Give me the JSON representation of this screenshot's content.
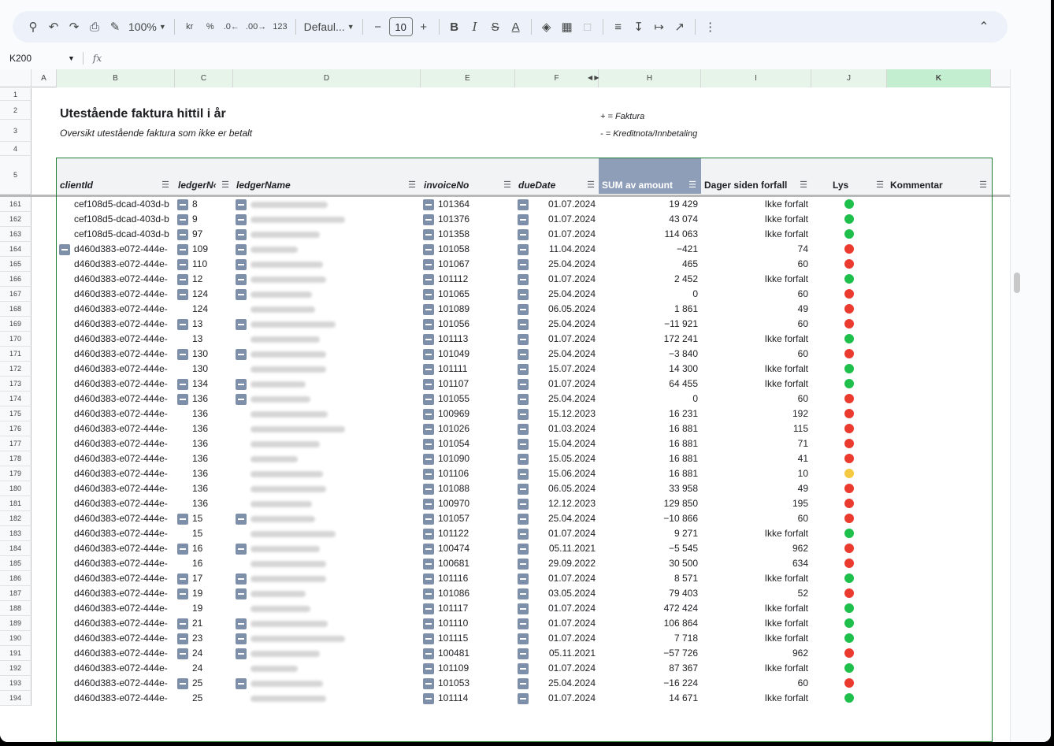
{
  "toolbar": {
    "zoom": "100%",
    "currency": "kr",
    "percent": "%",
    "dec_less": ".0←",
    "dec_more": ".00→",
    "format_123": "123",
    "font": "Defaul...",
    "font_size": "10",
    "bold": "B",
    "italic": "I",
    "text_color": "A",
    "more": "⋮"
  },
  "formula_bar": {
    "name_box": "K200",
    "fx": "fx"
  },
  "columns": [
    "A",
    "B",
    "C",
    "D",
    "E",
    "F",
    "H",
    "I",
    "J",
    "K"
  ],
  "sheet": {
    "title": "Utestående faktura hittil i år",
    "subtitle": "Oversikt utestående faktura som ikke er betalt",
    "legend_plus": "+ = Faktura",
    "legend_minus": "- = Kreditnota/Innbetaling"
  },
  "pivot_headers": {
    "clientId": "clientId",
    "ledgerNo": "ledgerN‹",
    "ledgerName": "ledgerName",
    "invoiceNo": "invoiceNo",
    "dueDate": "dueDate",
    "sum": "SUM av amount",
    "days": "Dager siden forfall",
    "lys": "Lys",
    "comment": "Kommentar"
  },
  "top_rows": [
    "1",
    "2",
    "3",
    "4",
    "5"
  ],
  "colors": {
    "green": "#1fbf4b",
    "red": "#ea3b2e",
    "yellow": "#f6c943",
    "pivot_button": "#7d8fa9",
    "sum_header": "#8e9eb8"
  },
  "rows": [
    {
      "n": "161",
      "client": "cef108d5-dcad-403d-b",
      "cm": false,
      "ledger": "8",
      "lm": true,
      "nm": true,
      "inv": "101364",
      "due": "01.07.2024",
      "sum": "19 429",
      "days": "Ikke forfalt",
      "lys": "green"
    },
    {
      "n": "162",
      "client": "cef108d5-dcad-403d-b",
      "cm": false,
      "ledger": "9",
      "lm": true,
      "nm": true,
      "inv": "101376",
      "due": "01.07.2024",
      "sum": "43 074",
      "days": "Ikke forfalt",
      "lys": "green"
    },
    {
      "n": "163",
      "client": "cef108d5-dcad-403d-b",
      "cm": false,
      "ledger": "97",
      "lm": true,
      "nm": true,
      "inv": "101358",
      "due": "01.07.2024",
      "sum": "114 063",
      "days": "Ikke forfalt",
      "lys": "green"
    },
    {
      "n": "164",
      "client": "d460d383-e072-444e-",
      "cm": true,
      "ledger": "109",
      "lm": true,
      "nm": true,
      "inv": "101058",
      "due": "11.04.2024",
      "sum": "−421",
      "days": "74",
      "lys": "red"
    },
    {
      "n": "165",
      "client": "d460d383-e072-444e-",
      "cm": false,
      "ledger": "110",
      "lm": true,
      "nm": true,
      "inv": "101067",
      "due": "25.04.2024",
      "sum": "465",
      "days": "60",
      "lys": "red"
    },
    {
      "n": "166",
      "client": "d460d383-e072-444e-",
      "cm": false,
      "ledger": "12",
      "lm": true,
      "nm": true,
      "inv": "101112",
      "due": "01.07.2024",
      "sum": "2 452",
      "days": "Ikke forfalt",
      "lys": "green"
    },
    {
      "n": "167",
      "client": "d460d383-e072-444e-",
      "cm": false,
      "ledger": "124",
      "lm": true,
      "nm": true,
      "inv": "101065",
      "due": "25.04.2024",
      "sum": "0",
      "days": "60",
      "lys": "red"
    },
    {
      "n": "168",
      "client": "d460d383-e072-444e-",
      "cm": false,
      "ledger": "124",
      "lm": false,
      "nm": false,
      "inv": "101089",
      "due": "06.05.2024",
      "sum": "1 861",
      "days": "49",
      "lys": "red"
    },
    {
      "n": "169",
      "client": "d460d383-e072-444e-",
      "cm": false,
      "ledger": "13",
      "lm": true,
      "nm": true,
      "inv": "101056",
      "due": "25.04.2024",
      "sum": "−11 921",
      "days": "60",
      "lys": "red"
    },
    {
      "n": "170",
      "client": "d460d383-e072-444e-",
      "cm": false,
      "ledger": "13",
      "lm": false,
      "nm": false,
      "inv": "101113",
      "due": "01.07.2024",
      "sum": "172 241",
      "days": "Ikke forfalt",
      "lys": "green"
    },
    {
      "n": "171",
      "client": "d460d383-e072-444e-",
      "cm": false,
      "ledger": "130",
      "lm": true,
      "nm": true,
      "inv": "101049",
      "due": "25.04.2024",
      "sum": "−3 840",
      "days": "60",
      "lys": "red"
    },
    {
      "n": "172",
      "client": "d460d383-e072-444e-",
      "cm": false,
      "ledger": "130",
      "lm": false,
      "nm": false,
      "inv": "101111",
      "due": "15.07.2024",
      "sum": "14 300",
      "days": "Ikke forfalt",
      "lys": "green"
    },
    {
      "n": "173",
      "client": "d460d383-e072-444e-",
      "cm": false,
      "ledger": "134",
      "lm": true,
      "nm": true,
      "inv": "101107",
      "due": "01.07.2024",
      "sum": "64 455",
      "days": "Ikke forfalt",
      "lys": "green"
    },
    {
      "n": "174",
      "client": "d460d383-e072-444e-",
      "cm": false,
      "ledger": "136",
      "lm": true,
      "nm": true,
      "inv": "101055",
      "due": "25.04.2024",
      "sum": "0",
      "days": "60",
      "lys": "red"
    },
    {
      "n": "175",
      "client": "d460d383-e072-444e-",
      "cm": false,
      "ledger": "136",
      "lm": false,
      "nm": false,
      "inv": "100969",
      "due": "15.12.2023",
      "sum": "16 231",
      "days": "192",
      "lys": "red"
    },
    {
      "n": "176",
      "client": "d460d383-e072-444e-",
      "cm": false,
      "ledger": "136",
      "lm": false,
      "nm": false,
      "inv": "101026",
      "due": "01.03.2024",
      "sum": "16 881",
      "days": "115",
      "lys": "red"
    },
    {
      "n": "177",
      "client": "d460d383-e072-444e-",
      "cm": false,
      "ledger": "136",
      "lm": false,
      "nm": false,
      "inv": "101054",
      "due": "15.04.2024",
      "sum": "16 881",
      "days": "71",
      "lys": "red"
    },
    {
      "n": "178",
      "client": "d460d383-e072-444e-",
      "cm": false,
      "ledger": "136",
      "lm": false,
      "nm": false,
      "inv": "101090",
      "due": "15.05.2024",
      "sum": "16 881",
      "days": "41",
      "lys": "red"
    },
    {
      "n": "179",
      "client": "d460d383-e072-444e-",
      "cm": false,
      "ledger": "136",
      "lm": false,
      "nm": false,
      "inv": "101106",
      "due": "15.06.2024",
      "sum": "16 881",
      "days": "10",
      "lys": "yellow"
    },
    {
      "n": "180",
      "client": "d460d383-e072-444e-",
      "cm": false,
      "ledger": "136",
      "lm": false,
      "nm": false,
      "inv": "101088",
      "due": "06.05.2024",
      "sum": "33 958",
      "days": "49",
      "lys": "red"
    },
    {
      "n": "181",
      "client": "d460d383-e072-444e-",
      "cm": false,
      "ledger": "136",
      "lm": false,
      "nm": false,
      "inv": "100970",
      "due": "12.12.2023",
      "sum": "129 850",
      "days": "195",
      "lys": "red"
    },
    {
      "n": "182",
      "client": "d460d383-e072-444e-",
      "cm": false,
      "ledger": "15",
      "lm": true,
      "nm": true,
      "inv": "101057",
      "due": "25.04.2024",
      "sum": "−10 866",
      "days": "60",
      "lys": "red"
    },
    {
      "n": "183",
      "client": "d460d383-e072-444e-",
      "cm": false,
      "ledger": "15",
      "lm": false,
      "nm": false,
      "inv": "101122",
      "due": "01.07.2024",
      "sum": "9 271",
      "days": "Ikke forfalt",
      "lys": "green"
    },
    {
      "n": "184",
      "client": "d460d383-e072-444e-",
      "cm": false,
      "ledger": "16",
      "lm": true,
      "nm": true,
      "inv": "100474",
      "due": "05.11.2021",
      "sum": "−5 545",
      "days": "962",
      "lys": "red"
    },
    {
      "n": "185",
      "client": "d460d383-e072-444e-",
      "cm": false,
      "ledger": "16",
      "lm": false,
      "nm": false,
      "inv": "100681",
      "due": "29.09.2022",
      "sum": "30 500",
      "days": "634",
      "lys": "red"
    },
    {
      "n": "186",
      "client": "d460d383-e072-444e-",
      "cm": false,
      "ledger": "17",
      "lm": true,
      "nm": true,
      "inv": "101116",
      "due": "01.07.2024",
      "sum": "8 571",
      "days": "Ikke forfalt",
      "lys": "green"
    },
    {
      "n": "187",
      "client": "d460d383-e072-444e-",
      "cm": false,
      "ledger": "19",
      "lm": true,
      "nm": true,
      "inv": "101086",
      "due": "03.05.2024",
      "sum": "79 403",
      "days": "52",
      "lys": "red"
    },
    {
      "n": "188",
      "client": "d460d383-e072-444e-",
      "cm": false,
      "ledger": "19",
      "lm": false,
      "nm": false,
      "inv": "101117",
      "due": "01.07.2024",
      "sum": "472 424",
      "days": "Ikke forfalt",
      "lys": "green"
    },
    {
      "n": "189",
      "client": "d460d383-e072-444e-",
      "cm": false,
      "ledger": "21",
      "lm": true,
      "nm": true,
      "inv": "101110",
      "due": "01.07.2024",
      "sum": "106 864",
      "days": "Ikke forfalt",
      "lys": "green"
    },
    {
      "n": "190",
      "client": "d460d383-e072-444e-",
      "cm": false,
      "ledger": "23",
      "lm": true,
      "nm": true,
      "inv": "101115",
      "due": "01.07.2024",
      "sum": "7 718",
      "days": "Ikke forfalt",
      "lys": "green"
    },
    {
      "n": "191",
      "client": "d460d383-e072-444e-",
      "cm": false,
      "ledger": "24",
      "lm": true,
      "nm": true,
      "inv": "100481",
      "due": "05.11.2021",
      "sum": "−57 726",
      "days": "962",
      "lys": "red"
    },
    {
      "n": "192",
      "client": "d460d383-e072-444e-",
      "cm": false,
      "ledger": "24",
      "lm": false,
      "nm": false,
      "inv": "101109",
      "due": "01.07.2024",
      "sum": "87 367",
      "days": "Ikke forfalt",
      "lys": "green"
    },
    {
      "n": "193",
      "client": "d460d383-e072-444e-",
      "cm": false,
      "ledger": "25",
      "lm": true,
      "nm": true,
      "inv": "101053",
      "due": "25.04.2024",
      "sum": "−16 224",
      "days": "60",
      "lys": "red"
    },
    {
      "n": "194",
      "client": "d460d383-e072-444e-",
      "cm": false,
      "ledger": "25",
      "lm": false,
      "nm": false,
      "inv": "101114",
      "due": "01.07.2024",
      "sum": "14 671",
      "days": "Ikke forfalt",
      "lys": "green"
    }
  ]
}
